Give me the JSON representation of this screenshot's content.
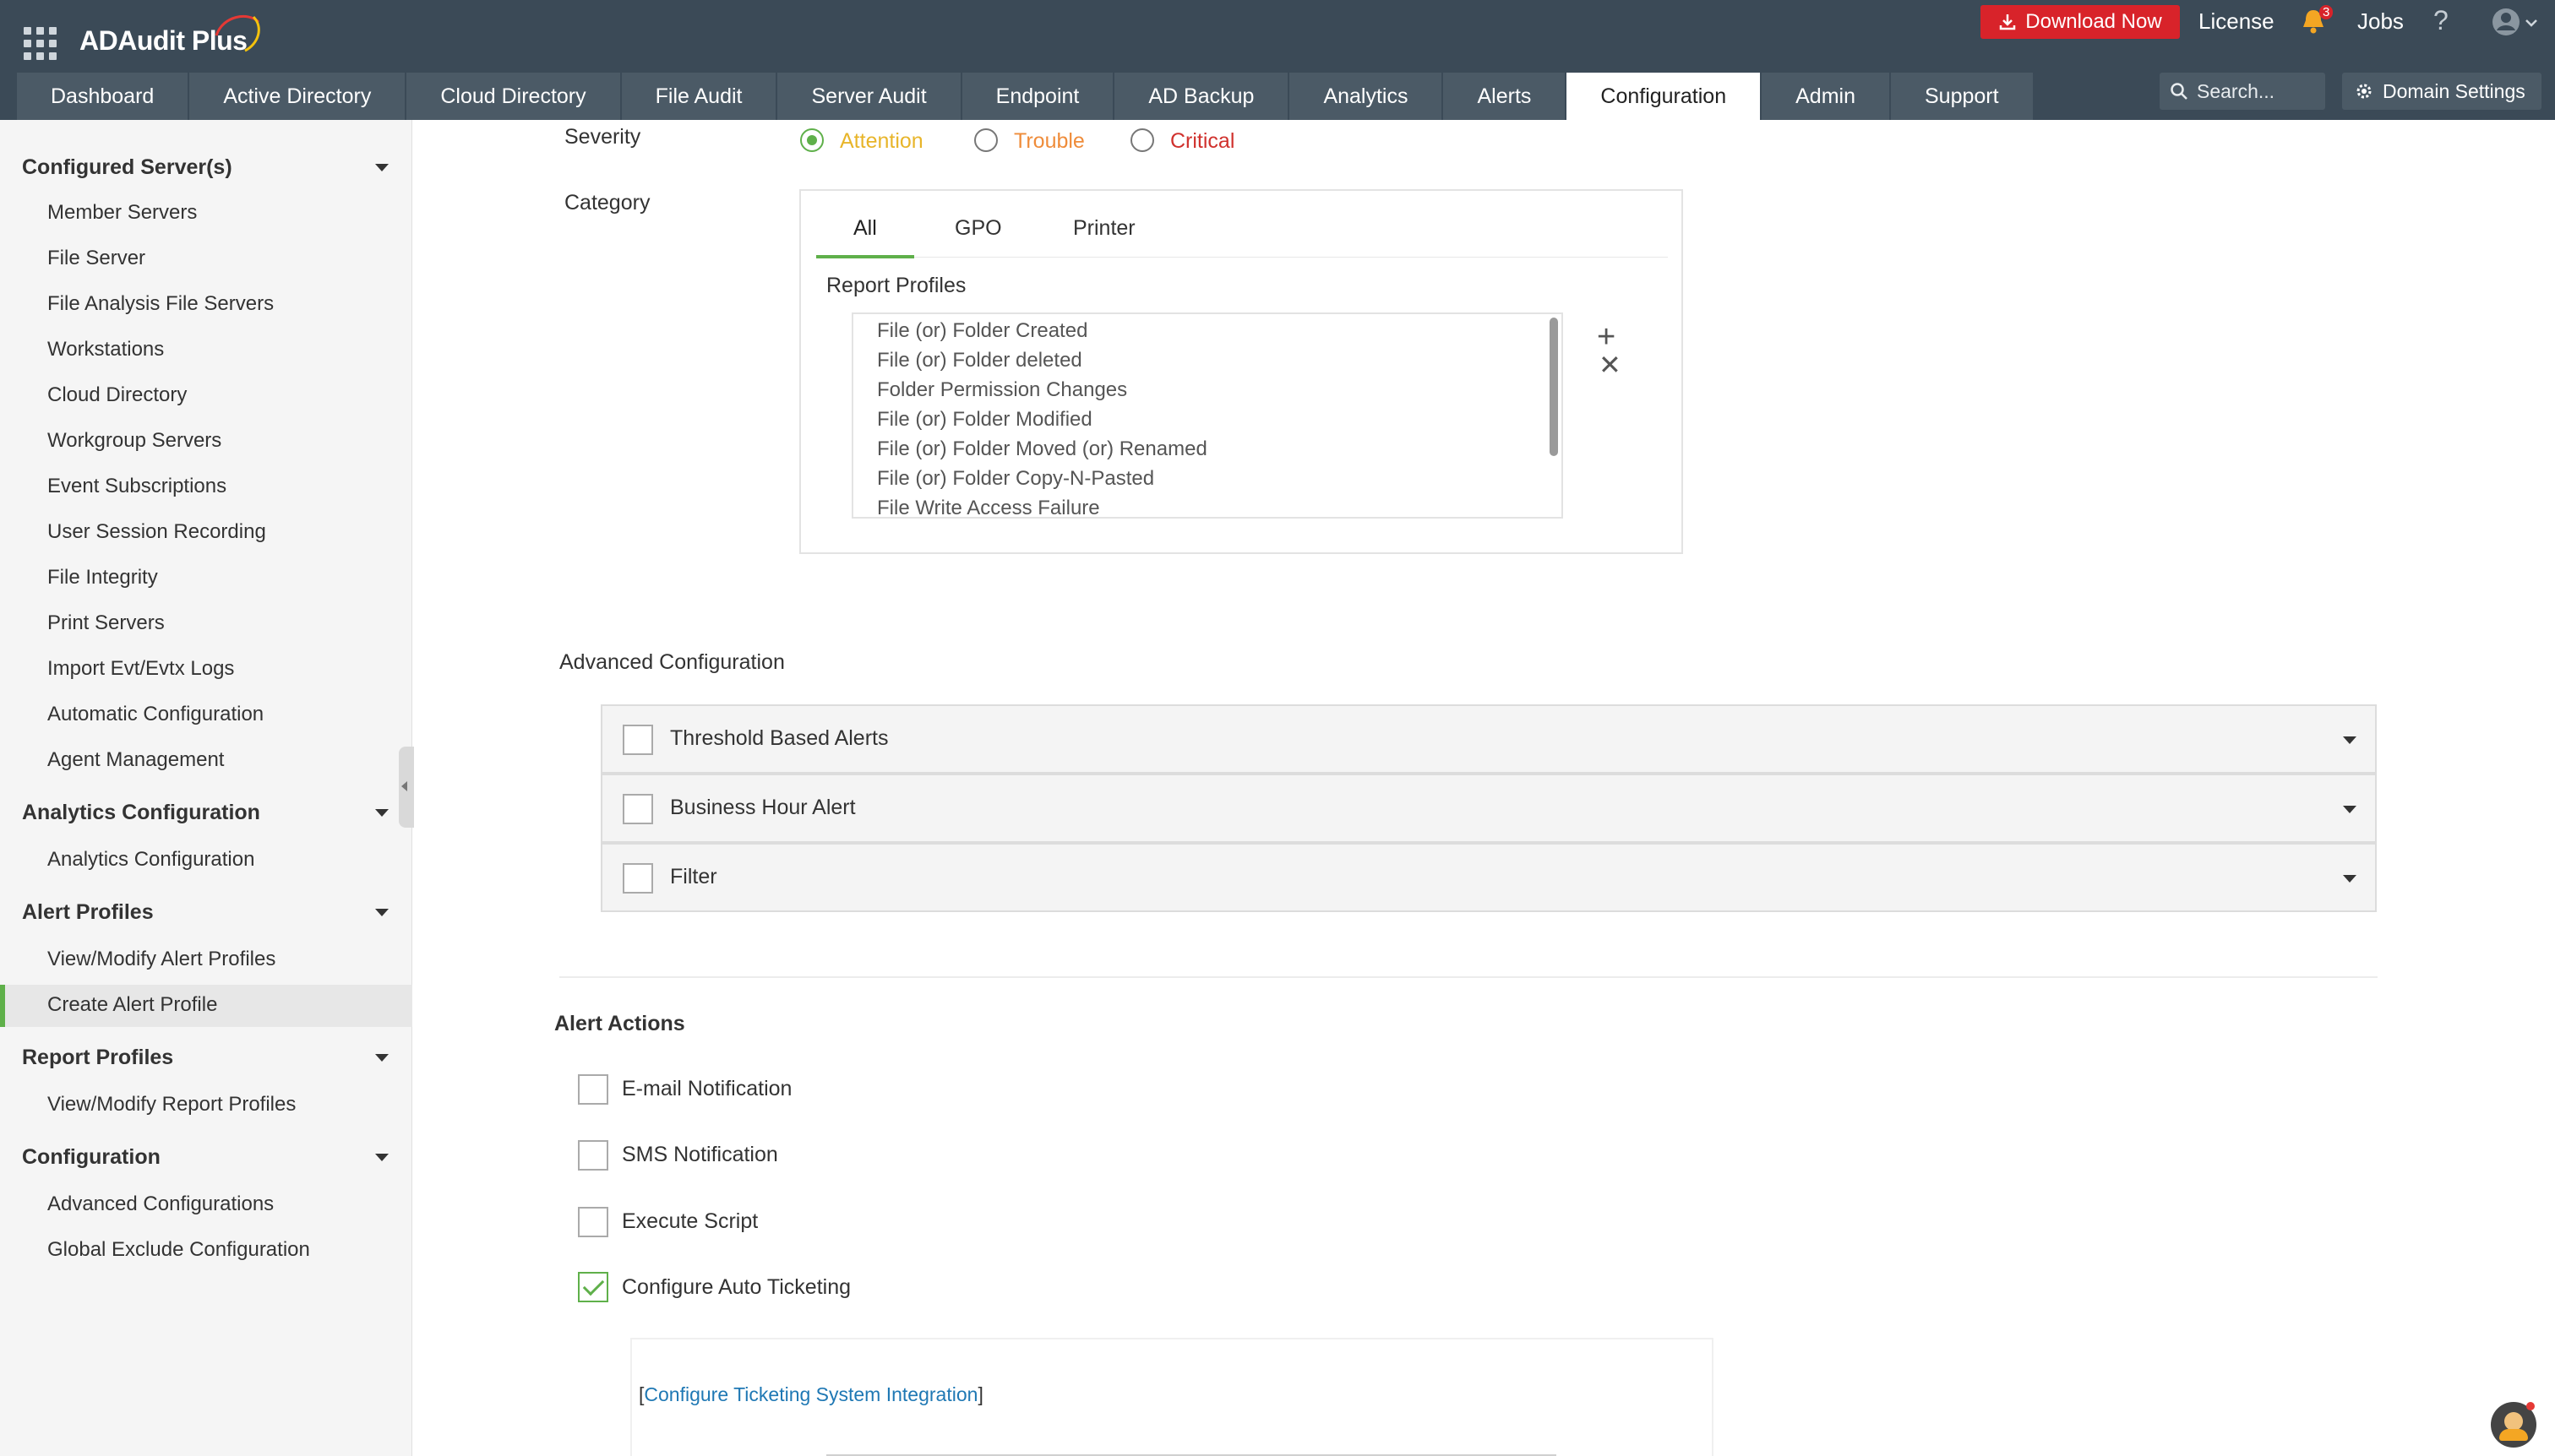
{
  "header": {
    "app_name": "ADAudit Plus",
    "download_label": "Download Now",
    "license_label": "License",
    "notification_count": "3",
    "jobs_label": "Jobs",
    "help_label": "?",
    "search_placeholder": "Search...",
    "domain_settings_label": "Domain Settings",
    "accent_color": "#d8232a"
  },
  "nav": {
    "tabs": [
      {
        "label": "Dashboard"
      },
      {
        "label": "Active Directory"
      },
      {
        "label": "Cloud Directory"
      },
      {
        "label": "File Audit"
      },
      {
        "label": "Server Audit"
      },
      {
        "label": "Endpoint"
      },
      {
        "label": "AD Backup"
      },
      {
        "label": "Analytics"
      },
      {
        "label": "Alerts"
      },
      {
        "label": "Configuration"
      },
      {
        "label": "Admin"
      },
      {
        "label": "Support"
      }
    ],
    "active_tab": "Configuration"
  },
  "sidebar": {
    "groups": [
      {
        "label": "Configured Server(s)",
        "items": [
          "Member Servers",
          "File Server",
          "File Analysis File Servers",
          "Workstations",
          "Cloud Directory",
          "Workgroup Servers",
          "Event Subscriptions",
          "User Session Recording",
          "File Integrity",
          "Print Servers",
          "Import Evt/Evtx Logs",
          "Automatic Configuration",
          "Agent Management"
        ]
      },
      {
        "label": "Analytics Configuration",
        "items": [
          "Analytics Configuration"
        ]
      },
      {
        "label": "Alert Profiles",
        "items": [
          "View/Modify Alert Profiles",
          "Create Alert Profile"
        ]
      },
      {
        "label": "Report Profiles",
        "items": [
          "View/Modify Report Profiles"
        ]
      },
      {
        "label": "Configuration",
        "items": [
          "Advanced Configurations",
          "Global Exclude Configuration"
        ]
      }
    ],
    "active_item": "Create Alert Profile",
    "active_color": "#5fb04a"
  },
  "form": {
    "severity_label": "Severity",
    "severity_options": [
      {
        "label": "Attention",
        "color": "#e8b52a",
        "selected": true
      },
      {
        "label": "Trouble",
        "color": "#ef8c3a",
        "selected": false
      },
      {
        "label": "Critical",
        "color": "#d0312d",
        "selected": false
      }
    ],
    "category_label": "Category",
    "category_tabs": [
      "All",
      "GPO",
      "Printer"
    ],
    "active_category_tab": "All",
    "report_profiles_label": "Report Profiles",
    "report_profiles": [
      "File (or) Folder Created",
      "File (or) Folder deleted",
      "Folder Permission Changes",
      "File (or) Folder Modified",
      "File (or) Folder Moved (or) Renamed",
      "File (or) Folder Copy-N-Pasted",
      "File Write Access Failure"
    ],
    "add_label": "+",
    "remove_label": "✕"
  },
  "advanced": {
    "title": "Advanced Configuration",
    "sections": [
      {
        "label": "Threshold Based Alerts",
        "checked": false
      },
      {
        "label": "Business Hour Alert",
        "checked": false
      },
      {
        "label": "Filter",
        "checked": false
      }
    ]
  },
  "alert_actions": {
    "title": "Alert Actions",
    "options": [
      {
        "label": "E-mail Notification",
        "checked": false
      },
      {
        "label": "SMS Notification",
        "checked": false
      },
      {
        "label": "Execute Script",
        "checked": false
      },
      {
        "label": "Configure Auto Ticketing",
        "checked": true
      }
    ],
    "ticketing_link_open": "[",
    "ticketing_link_label": "Configure Ticketing System Integration",
    "ticketing_link_close": "]"
  }
}
